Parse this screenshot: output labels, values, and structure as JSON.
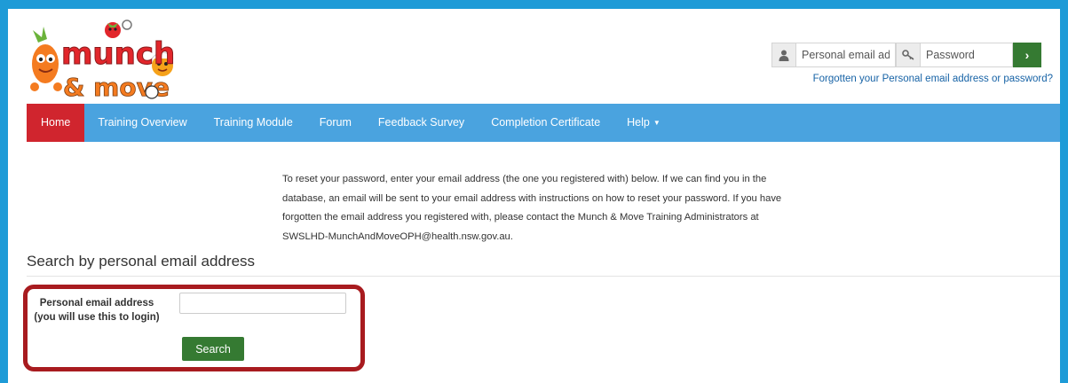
{
  "colors": {
    "page_border": "#1e9bd7",
    "navbar": "#4aa3df",
    "nav_active": "#d0252e",
    "button_green": "#357a32",
    "highlight_border": "#a81b1f",
    "link": "#1763a6"
  },
  "header": {
    "logo": {
      "line1": "munch",
      "line2": "& move"
    },
    "login": {
      "user_icon": "user-icon",
      "email_placeholder": "Personal email ad",
      "key_icon": "key-icon",
      "password_placeholder": "Password",
      "submit_icon": "chevron-right-icon",
      "submit_glyph": "›"
    },
    "forgot_link": "Forgotten your Personal email address or password?"
  },
  "nav": {
    "items": [
      {
        "label": "Home",
        "active": true
      },
      {
        "label": "Training Overview"
      },
      {
        "label": "Training Module"
      },
      {
        "label": "Forum"
      },
      {
        "label": "Feedback Survey"
      },
      {
        "label": "Completion Certificate"
      },
      {
        "label": "Help"
      }
    ],
    "help_caret": "▼"
  },
  "main": {
    "intro_text": "To reset your password, enter your email address (the one you registered with) below. If we can find you in the database, an email will be sent to your email address with instructions on how to reset your password. If you have forgotten the email address you registered with, please contact the Munch & Move Training Administrators at SWSLHD-MunchAndMoveOPH@health.nsw.gov.au.",
    "section_title": "Search by personal email address",
    "form": {
      "label_line1": "Personal email address",
      "label_line2": "(you will use this to login)",
      "email_value": "",
      "search_button": "Search"
    }
  }
}
